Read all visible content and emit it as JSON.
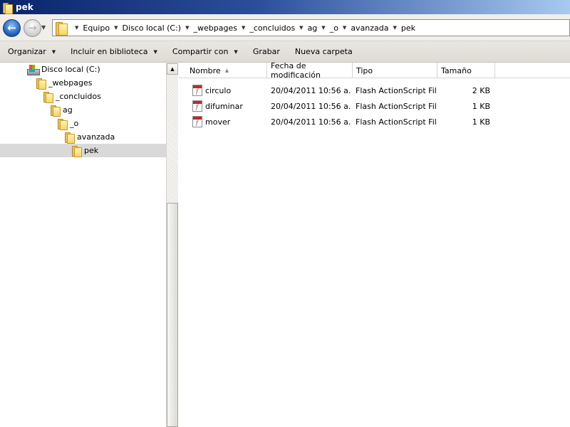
{
  "window": {
    "title": "pek"
  },
  "addressbar": {
    "crumbs": [
      "Equipo",
      "Disco local (C:)",
      "_webpages",
      "_concluidos",
      "ag",
      "_o",
      "avanzada",
      "pek"
    ]
  },
  "toolbar": {
    "organize": "Organizar",
    "include_library": "Incluir en biblioteca",
    "share_with": "Compartir con",
    "burn": "Grabar",
    "new_folder": "Nueva carpeta"
  },
  "navpane": {
    "items": [
      {
        "label": "Disco local (C:)",
        "icon": "drive-icon",
        "level": 0
      },
      {
        "label": "_webpages",
        "icon": "folder-icon",
        "level": 1
      },
      {
        "label": "_concluidos",
        "icon": "folder-icon",
        "level": 2
      },
      {
        "label": "ag",
        "icon": "folder-icon",
        "level": 3
      },
      {
        "label": "_o",
        "icon": "folder-icon",
        "level": 4
      },
      {
        "label": "avanzada",
        "icon": "folder-icon",
        "level": 5
      },
      {
        "label": "pek",
        "icon": "folder-icon",
        "level": 6,
        "selected": true
      }
    ]
  },
  "filelist": {
    "columns": {
      "name": "Nombre",
      "date": "Fecha de modificación",
      "type": "Tipo",
      "size": "Tamaño"
    },
    "files": [
      {
        "name": "circulo",
        "date": "20/04/2011 10:56 a...",
        "type": "Flash ActionScript File",
        "size": "2 KB"
      },
      {
        "name": "difuminar",
        "date": "20/04/2011 10:56 a...",
        "type": "Flash ActionScript File",
        "size": "1 KB"
      },
      {
        "name": "mover",
        "date": "20/04/2011 10:56 a...",
        "type": "Flash ActionScript File",
        "size": "1 KB"
      }
    ]
  },
  "colors": {
    "titlebar": "#0a246a",
    "selection": "#d9d9d9"
  }
}
